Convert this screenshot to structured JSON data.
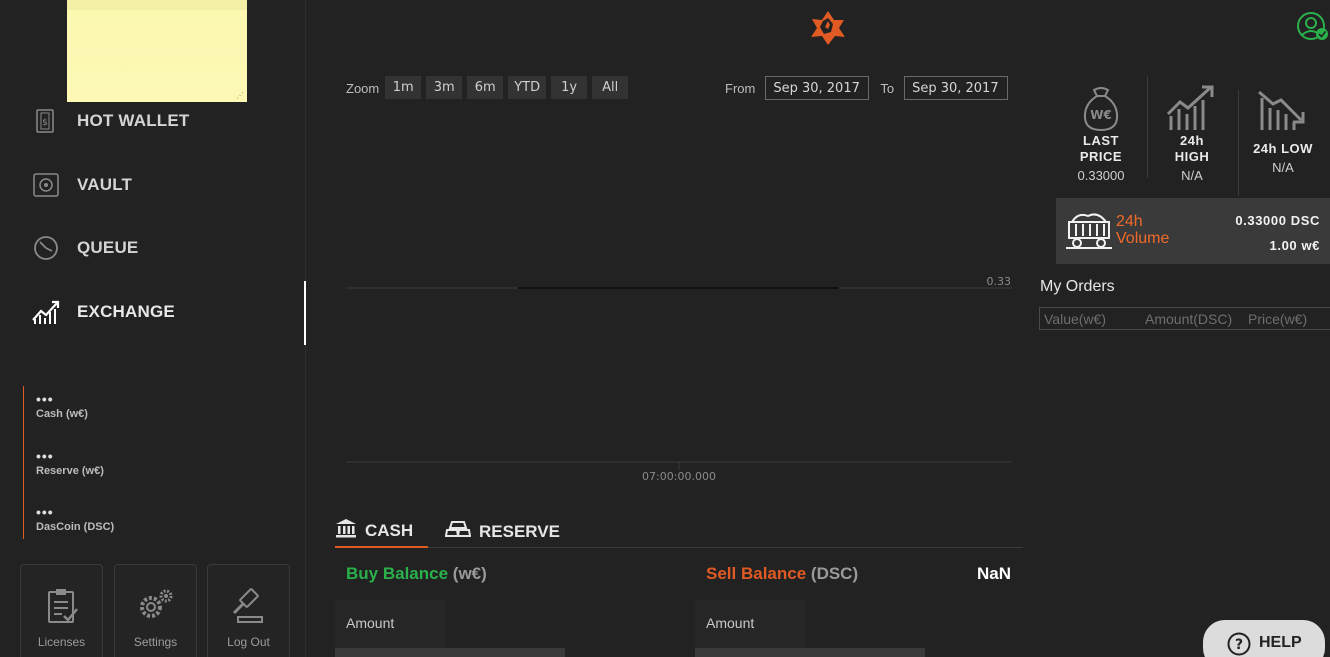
{
  "sidebar": {
    "nav": [
      {
        "label": "HOT WALLET",
        "icon": "hot-wallet-icon"
      },
      {
        "label": "VAULT",
        "icon": "vault-icon"
      },
      {
        "label": "QUEUE",
        "icon": "queue-icon"
      },
      {
        "label": "EXCHANGE",
        "icon": "exchange-chart-icon",
        "active": true
      }
    ],
    "balances": [
      {
        "value": "•••",
        "label": "Cash (w€)"
      },
      {
        "value": "•••",
        "label": "Reserve (w€)"
      },
      {
        "value": "•••",
        "label": "DasCoin (DSC)"
      }
    ],
    "tiles": [
      {
        "label": "Licenses",
        "icon": "licenses-icon"
      },
      {
        "label": "Settings",
        "icon": "settings-gears-icon"
      },
      {
        "label": "Log Out",
        "icon": "logout-gavel-icon"
      }
    ],
    "accent_color": "#e05a24"
  },
  "chart_toolbar": {
    "zoom_label": "Zoom",
    "zoom_buttons": [
      "1m",
      "3m",
      "6m",
      "YTD",
      "1y",
      "All"
    ],
    "from_label": "From",
    "from_value": "Sep 30, 2017",
    "to_label": "To",
    "to_value": "Sep 30, 2017"
  },
  "chart_data": {
    "type": "line",
    "x_tick_labels": [
      "07:00:00.000"
    ],
    "y_tick_labels": [
      "0.33"
    ],
    "series": [
      {
        "x": [
          "07:00:00.000"
        ],
        "values": [
          0.33
        ]
      }
    ]
  },
  "stats": {
    "last_price_title_1": "LAST",
    "last_price_title_2": "PRICE",
    "last_price_value": "0.33000",
    "high_title_1": "24h",
    "high_title_2": "HIGH",
    "high_value": "N/A",
    "low_title": "24h LOW",
    "low_value": "N/A"
  },
  "volume": {
    "label_1": "24h",
    "label_2": "Volume",
    "dsc_value": "0.33000 DSC",
    "we_value": "1.00 w€"
  },
  "orders": {
    "title": "My Orders",
    "columns": [
      "Value(w€)",
      "Amount(DSC)",
      "Price(w€)"
    ]
  },
  "tabs": [
    {
      "label": "CASH",
      "active": true
    },
    {
      "label": "RESERVE",
      "active": false
    }
  ],
  "trade": {
    "buy_label": "Buy Balance",
    "buy_currency": "(w€)",
    "sell_label": "Sell Balance",
    "sell_currency": "(DSC)",
    "sell_value": "NaN",
    "buy_amount_label": "Amount",
    "sell_amount_label": "Amount",
    "buy_color": "#2ab14b",
    "sell_color": "#e05a24"
  },
  "help": {
    "label": "HELP"
  }
}
